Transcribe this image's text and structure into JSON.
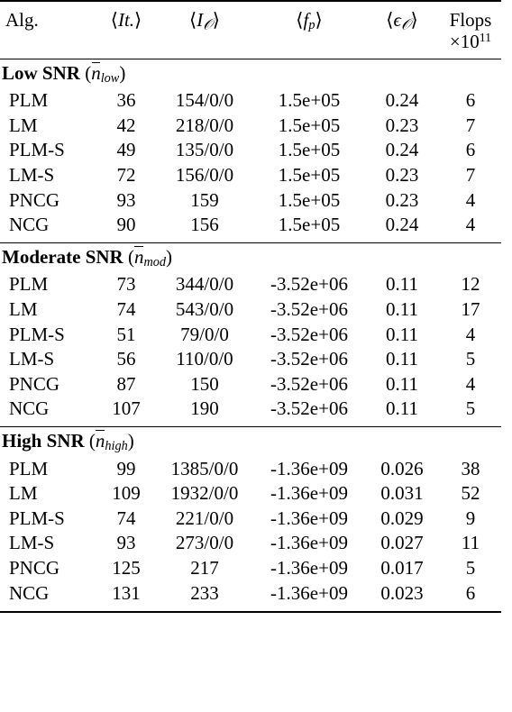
{
  "table": {
    "columns": [
      {
        "key": "alg",
        "header": "Alg.",
        "header_math": false,
        "align": "left"
      },
      {
        "key": "it",
        "header": "⟨It.⟩",
        "align": "center"
      },
      {
        "key": "io",
        "header": "⟨Iℴ⟩",
        "align": "center"
      },
      {
        "key": "fp",
        "header": "⟨fₚ⟩",
        "align": "center"
      },
      {
        "key": "eps",
        "header": "⟨ϵℴ⟩",
        "align": "center"
      },
      {
        "key": "flops",
        "header": "Flops",
        "header_line2": "×10¹¹",
        "align": "center"
      }
    ],
    "sections": [
      {
        "title": "Low SNR",
        "param": "(n̄_low)",
        "param_base": "n",
        "param_sub": "low",
        "rows": [
          {
            "alg": "PLM",
            "it": "36",
            "io": "154/0/0",
            "fp": "1.5e+05",
            "eps": "0.24",
            "flops": "6"
          },
          {
            "alg": "LM",
            "it": "42",
            "io": "218/0/0",
            "fp": "1.5e+05",
            "eps": "0.23",
            "flops": "7"
          },
          {
            "alg": "PLM-S",
            "it": "49",
            "io": "135/0/0",
            "fp": "1.5e+05",
            "eps": "0.24",
            "flops": "6"
          },
          {
            "alg": "LM-S",
            "it": "72",
            "io": "156/0/0",
            "fp": "1.5e+05",
            "eps": "0.23",
            "flops": "7"
          },
          {
            "alg": "PNCG",
            "it": "93",
            "io": "159",
            "fp": "1.5e+05",
            "eps": "0.23",
            "flops": "4"
          },
          {
            "alg": "NCG",
            "it": "90",
            "io": "156",
            "fp": "1.5e+05",
            "eps": "0.24",
            "flops": "4"
          }
        ]
      },
      {
        "title": "Moderate SNR",
        "param": "(n̄_mod)",
        "param_base": "n",
        "param_sub": "mod",
        "rows": [
          {
            "alg": "PLM",
            "it": "73",
            "io": "344/0/0",
            "fp": "-3.52e+06",
            "eps": "0.11",
            "flops": "12"
          },
          {
            "alg": "LM",
            "it": "74",
            "io": "543/0/0",
            "fp": "-3.52e+06",
            "eps": "0.11",
            "flops": "17"
          },
          {
            "alg": "PLM-S",
            "it": "51",
            "io": "79/0/0",
            "fp": "-3.52e+06",
            "eps": "0.11",
            "flops": "4"
          },
          {
            "alg": "LM-S",
            "it": "56",
            "io": "110/0/0",
            "fp": "-3.52e+06",
            "eps": "0.11",
            "flops": "5"
          },
          {
            "alg": "PNCG",
            "it": "87",
            "io": "150",
            "fp": "-3.52e+06",
            "eps": "0.11",
            "flops": "4"
          },
          {
            "alg": "NCG",
            "it": "107",
            "io": "190",
            "fp": "-3.52e+06",
            "eps": "0.11",
            "flops": "5"
          }
        ]
      },
      {
        "title": "High SNR",
        "param": "(n̄_high)",
        "param_base": "n",
        "param_sub": "high",
        "rows": [
          {
            "alg": "PLM",
            "it": "99",
            "io": "1385/0/0",
            "fp": "-1.36e+09",
            "eps": "0.026",
            "flops": "38"
          },
          {
            "alg": "LM",
            "it": "109",
            "io": "1932/0/0",
            "fp": "-1.36e+09",
            "eps": "0.031",
            "flops": "52"
          },
          {
            "alg": "PLM-S",
            "it": "74",
            "io": "221/0/0",
            "fp": "-1.36e+09",
            "eps": "0.029",
            "flops": "9"
          },
          {
            "alg": "LM-S",
            "it": "93",
            "io": "273/0/0",
            "fp": "-1.36e+09",
            "eps": "0.027",
            "flops": "11"
          },
          {
            "alg": "PNCG",
            "it": "125",
            "io": "217",
            "fp": "-1.36e+09",
            "eps": "0.017",
            "flops": "5"
          },
          {
            "alg": "NCG",
            "it": "131",
            "io": "233",
            "fp": "-1.36e+09",
            "eps": "0.023",
            "flops": "6"
          }
        ]
      }
    ]
  },
  "colors": {
    "text": "#000000",
    "background": "#ffffff",
    "rule": "#000000"
  }
}
